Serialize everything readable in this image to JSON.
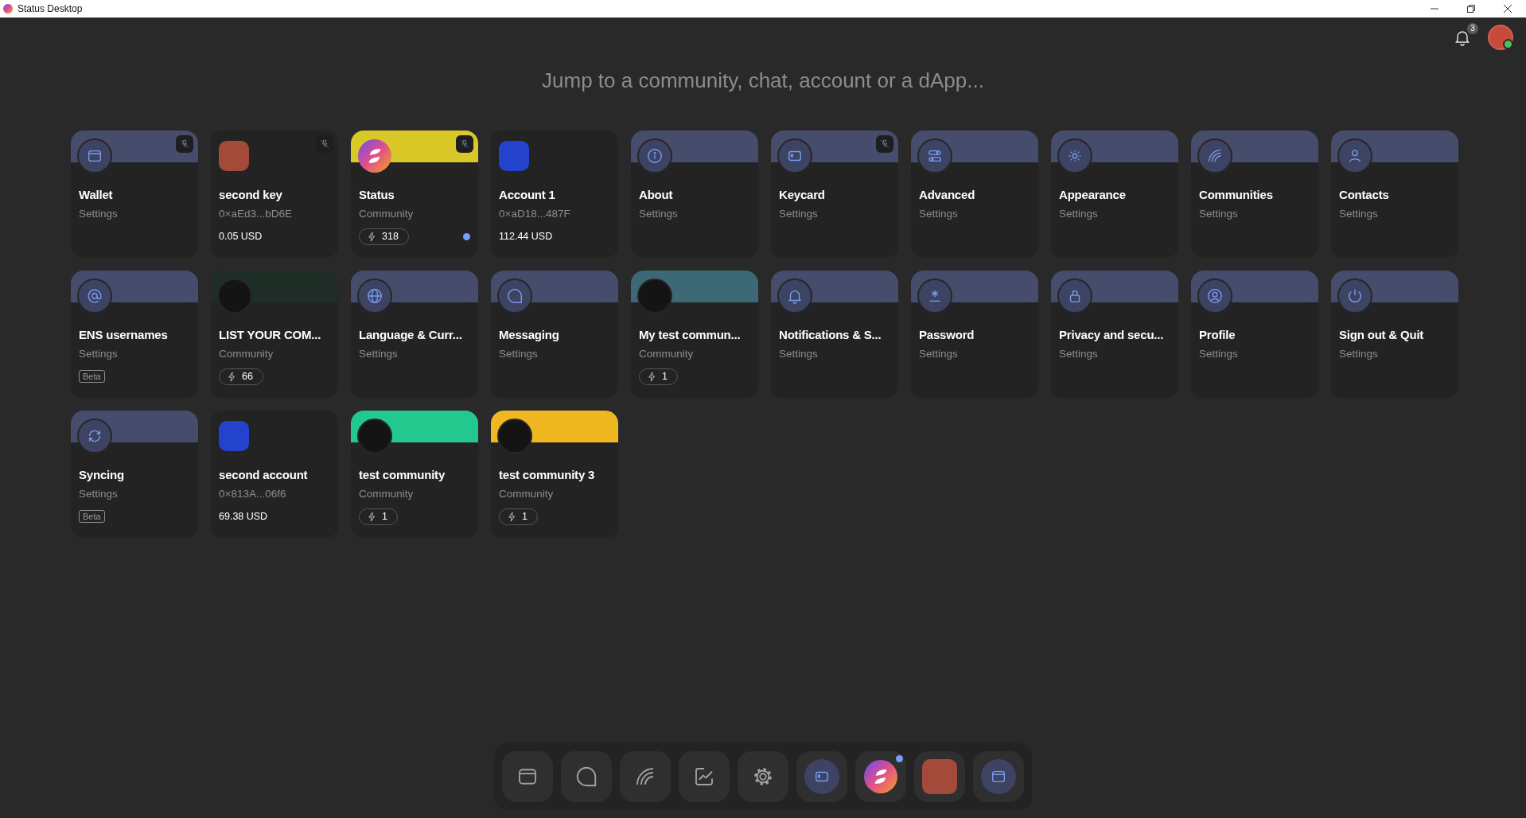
{
  "window": {
    "title": "Status Desktop"
  },
  "notifications": {
    "count": "3"
  },
  "profile": {
    "online": true
  },
  "search": {
    "placeholder": "Jump to a community, chat, account or a dApp..."
  },
  "cards": [
    {
      "kind": "settings",
      "title": "Wallet",
      "subtitle": "Settings",
      "pinned": true,
      "unread": false
    },
    {
      "kind": "account",
      "title": "second key",
      "subtitle": "0×aEd3...bD6E",
      "balance": "0.05 USD",
      "color": "#a34a3a",
      "pinned": true,
      "unread": false
    },
    {
      "kind": "community",
      "title": "Status",
      "subtitle": "Community",
      "members": "318",
      "color": "#d8c828",
      "pinned": true,
      "unread": true
    },
    {
      "kind": "account",
      "title": "Account 1",
      "subtitle": "0×aD18...487F",
      "balance": "112.44 USD",
      "color": "#2443cc",
      "pinned": false,
      "unread": false
    },
    {
      "kind": "settings",
      "title": "About",
      "subtitle": "Settings",
      "pinned": false,
      "unread": false
    },
    {
      "kind": "settings",
      "title": "Keycard",
      "subtitle": "Settings",
      "pinned": true,
      "unread": false
    },
    {
      "kind": "settings",
      "title": "Advanced",
      "subtitle": "Settings",
      "pinned": false,
      "unread": false
    },
    {
      "kind": "settings",
      "title": "Appearance",
      "subtitle": "Settings",
      "pinned": false,
      "unread": false
    },
    {
      "kind": "settings",
      "title": "Communities",
      "subtitle": "Settings",
      "pinned": false,
      "unread": false
    },
    {
      "kind": "settings",
      "title": "Contacts",
      "subtitle": "Settings",
      "pinned": false,
      "unread": false
    },
    {
      "kind": "settings",
      "title": "ENS usernames",
      "subtitle": "Settings",
      "badge": "Beta",
      "pinned": false,
      "unread": false
    },
    {
      "kind": "community",
      "title": "LIST YOUR COM...",
      "subtitle": "Community",
      "members": "66",
      "color": "#1e2e26",
      "pinned": false,
      "unread": false
    },
    {
      "kind": "settings",
      "title": "Language & Curr...",
      "subtitle": "Settings",
      "pinned": false,
      "unread": false
    },
    {
      "kind": "settings",
      "title": "Messaging",
      "subtitle": "Settings",
      "pinned": false,
      "unread": false
    },
    {
      "kind": "community",
      "title": "My test commun...",
      "subtitle": "Community",
      "members": "1",
      "color": "#3d6876",
      "pinned": false,
      "unread": false
    },
    {
      "kind": "settings",
      "title": "Notifications & S...",
      "subtitle": "Settings",
      "pinned": false,
      "unread": false
    },
    {
      "kind": "settings",
      "title": "Password",
      "subtitle": "Settings",
      "pinned": false,
      "unread": false
    },
    {
      "kind": "settings",
      "title": "Privacy and secu...",
      "subtitle": "Settings",
      "pinned": false,
      "unread": false
    },
    {
      "kind": "settings",
      "title": "Profile",
      "subtitle": "Settings",
      "pinned": false,
      "unread": false
    },
    {
      "kind": "settings",
      "title": "Sign out & Quit",
      "subtitle": "Settings",
      "pinned": false,
      "unread": false
    },
    {
      "kind": "settings",
      "title": "Syncing",
      "subtitle": "Settings",
      "badge": "Beta",
      "pinned": false,
      "unread": false
    },
    {
      "kind": "account",
      "title": "second account",
      "subtitle": "0×813A...06f6",
      "balance": "69.38 USD",
      "color": "#2443cc",
      "pinned": false,
      "unread": false
    },
    {
      "kind": "community",
      "title": "test community",
      "subtitle": "Community",
      "members": "1",
      "color": "#22c88e",
      "pinned": false,
      "unread": false
    },
    {
      "kind": "community",
      "title": "test community 3",
      "subtitle": "Community",
      "members": "1",
      "color": "#f0b820",
      "pinned": false,
      "unread": false
    }
  ],
  "dock": [
    {
      "kind": "section",
      "unread": false
    },
    {
      "kind": "section",
      "unread": false
    },
    {
      "kind": "section",
      "unread": false
    },
    {
      "kind": "section",
      "unread": false
    },
    {
      "kind": "section",
      "unread": false
    },
    {
      "kind": "pinned",
      "unread": false
    },
    {
      "kind": "pinned",
      "unread": true
    },
    {
      "kind": "pinned",
      "unread": false
    },
    {
      "kind": "pinned",
      "unread": false
    }
  ]
}
